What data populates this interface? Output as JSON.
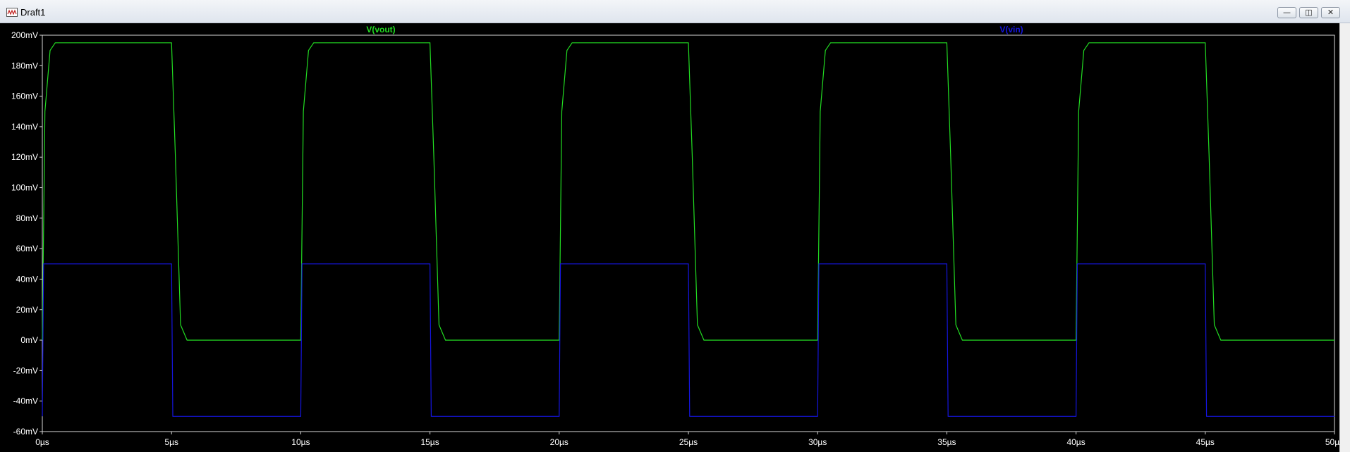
{
  "window": {
    "title": "Draft1",
    "buttons": {
      "minimize": "—",
      "restore": "◫",
      "close": "✕"
    }
  },
  "colors": {
    "background": "#000000",
    "axis": "#d8d8d8",
    "tick_text": "#ffffff",
    "vout": "#22dd22",
    "vin": "#1515e0"
  },
  "chart_data": {
    "type": "line",
    "title": "",
    "xlabel": "",
    "ylabel": "",
    "xlim": [
      0,
      50
    ],
    "ylim": [
      -60,
      200
    ],
    "x_unit": "µs",
    "y_unit": "mV",
    "grid": false,
    "x_ticks": [
      "0µs",
      "5µs",
      "10µs",
      "15µs",
      "20µs",
      "25µs",
      "30µs",
      "35µs",
      "40µs",
      "45µs",
      "50µs"
    ],
    "y_ticks": [
      "200mV",
      "180mV",
      "160mV",
      "140mV",
      "120mV",
      "100mV",
      "80mV",
      "60mV",
      "40mV",
      "20mV",
      "0mV",
      "-20mV",
      "-40mV",
      "-60mV"
    ],
    "x_tick_values": [
      0,
      5,
      10,
      15,
      20,
      25,
      30,
      35,
      40,
      45,
      50
    ],
    "y_tick_values": [
      200,
      180,
      160,
      140,
      120,
      100,
      80,
      60,
      40,
      20,
      0,
      -20,
      -40,
      -60
    ],
    "series": [
      {
        "name": "V(vout)",
        "color": "#22dd22",
        "label_position": "top-left",
        "high": 195,
        "low": 0,
        "period": 10,
        "high_duration": 5,
        "x": [
          0,
          0.1,
          0.3,
          0.5,
          5.0,
          5.15,
          5.35,
          5.6,
          10.0,
          10.1,
          10.3,
          10.5,
          15.0,
          15.15,
          15.35,
          15.6,
          20.0,
          20.1,
          20.3,
          20.5,
          25.0,
          25.15,
          25.35,
          25.6,
          30.0,
          30.1,
          30.3,
          30.5,
          35.0,
          35.15,
          35.35,
          35.6,
          40.0,
          40.1,
          40.3,
          40.5,
          45.0,
          45.15,
          45.35,
          45.6,
          50.0
        ],
        "y": [
          0,
          150,
          190,
          195,
          195,
          120,
          10,
          0,
          0,
          150,
          190,
          195,
          195,
          120,
          10,
          0,
          0,
          150,
          190,
          195,
          195,
          120,
          10,
          0,
          0,
          150,
          190,
          195,
          195,
          120,
          10,
          0,
          0,
          150,
          190,
          195,
          195,
          120,
          10,
          0,
          0
        ]
      },
      {
        "name": "V(vin)",
        "color": "#1515e0",
        "label_position": "top-right",
        "high": 50,
        "low": -50,
        "period": 10,
        "high_duration": 5,
        "x": [
          0,
          0.05,
          5.0,
          5.05,
          10.0,
          10.05,
          15.0,
          15.05,
          20.0,
          20.05,
          25.0,
          25.05,
          30.0,
          30.05,
          35.0,
          35.05,
          40.0,
          40.05,
          45.0,
          45.05,
          50.0
        ],
        "y": [
          -50,
          50,
          50,
          -50,
          -50,
          50,
          50,
          -50,
          -50,
          50,
          50,
          -50,
          -50,
          50,
          50,
          -50,
          -50,
          50,
          50,
          -50,
          -50
        ]
      }
    ]
  }
}
